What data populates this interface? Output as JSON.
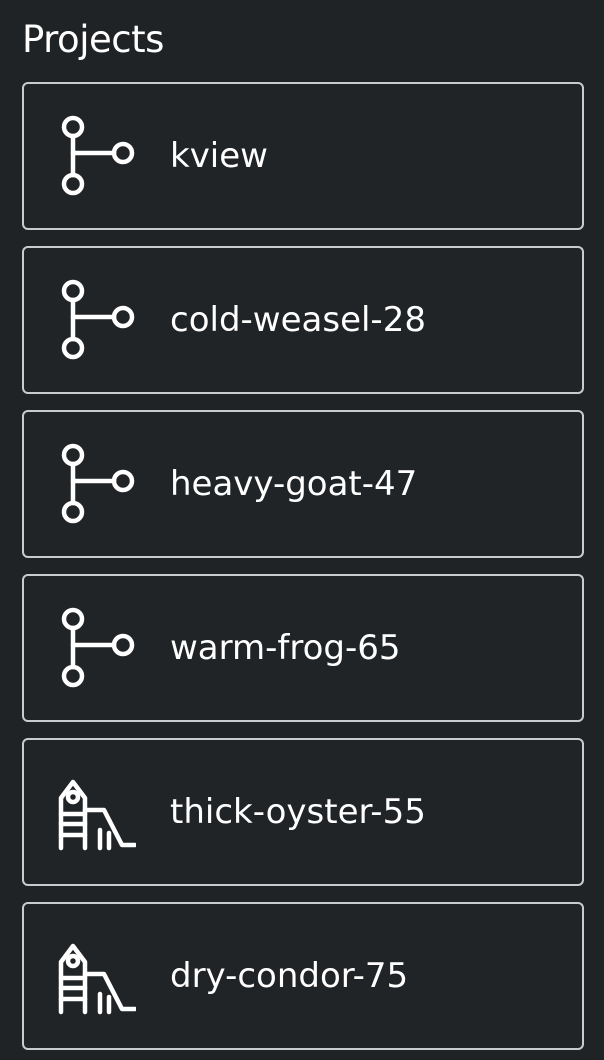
{
  "page": {
    "title": "Projects"
  },
  "projects": [
    {
      "name": "kview",
      "icon": "git-branch-icon"
    },
    {
      "name": "cold-weasel-28",
      "icon": "git-branch-icon"
    },
    {
      "name": "heavy-goat-47",
      "icon": "git-branch-icon"
    },
    {
      "name": "warm-frog-65",
      "icon": "git-branch-icon"
    },
    {
      "name": "thick-oyster-55",
      "icon": "playground-slide-icon"
    },
    {
      "name": "dry-condor-75",
      "icon": "playground-slide-icon"
    }
  ],
  "colors": {
    "background": "#202326",
    "card_border": "#c9cccf",
    "text": "#ffffff"
  }
}
